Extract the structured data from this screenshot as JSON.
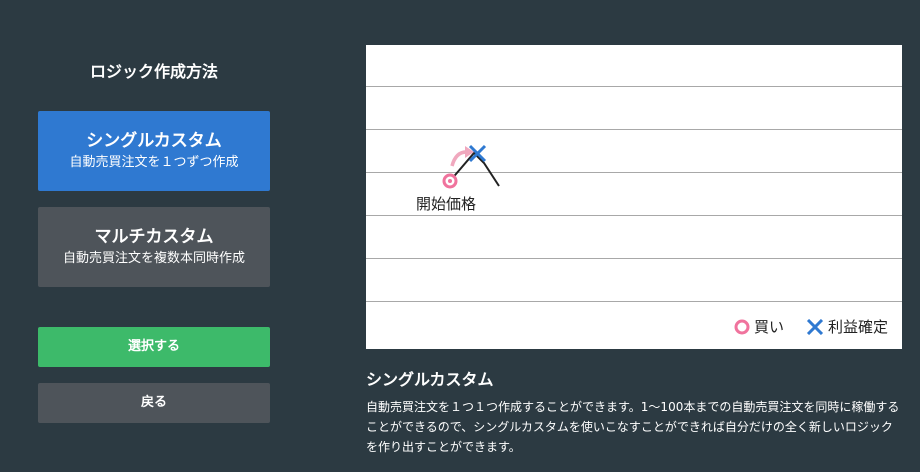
{
  "left": {
    "title": "ロジック作成方法",
    "options": [
      {
        "name": "シングルカスタム",
        "desc": "自動売買注文を１つずつ作成"
      },
      {
        "name": "マルチカスタム",
        "desc": "自動売買注文を複数本同時作成"
      }
    ],
    "select_label": "選択する",
    "back_label": "戻る"
  },
  "chart": {
    "start_label": "開始価格",
    "legend": {
      "buy": "買い",
      "profit": "利益確定"
    },
    "colors": {
      "buy": "#f0739d",
      "profit": "#2f79d1",
      "arrow": "#f0a8be"
    }
  },
  "info": {
    "title": "シングルカスタム",
    "text": "自動売買注文を１つ１つ作成することができます。1〜100本までの自動売買注文を同時に稼働することができるので、シングルカスタムを使いこなすことができれば自分だけの全く新しいロジックを作り出すことができます。"
  }
}
